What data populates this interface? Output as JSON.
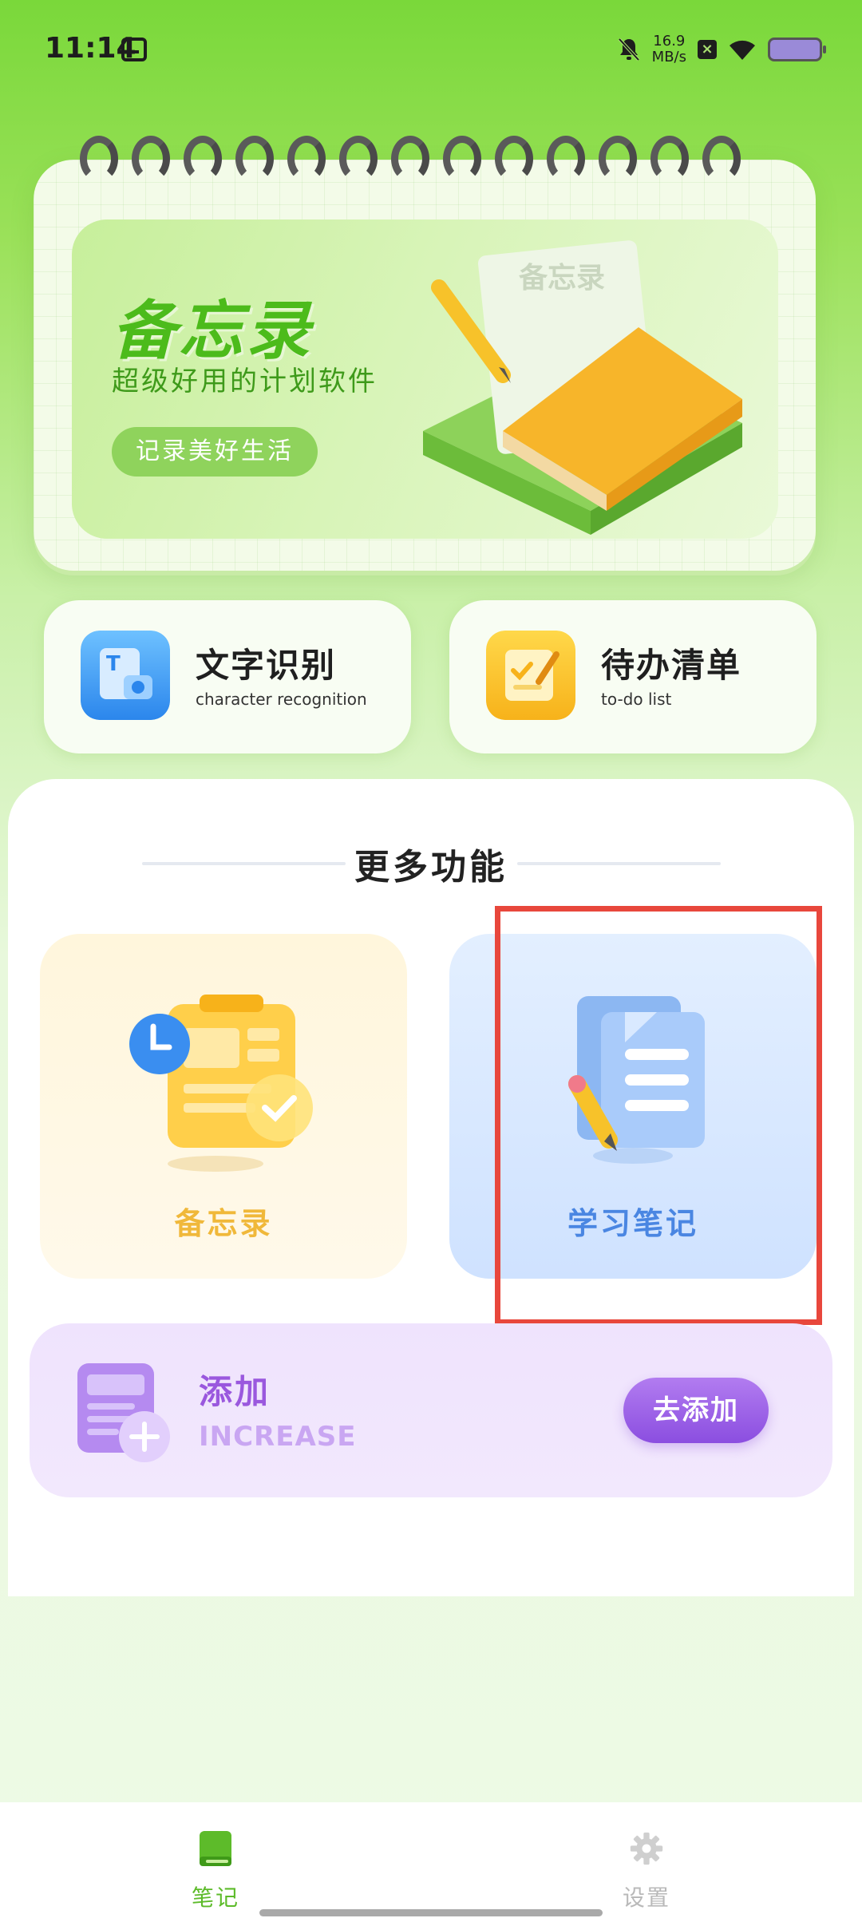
{
  "status_bar": {
    "time": "11:14",
    "net_speed_value": "16.9",
    "net_speed_unit": "MB/s",
    "x_badge": "×"
  },
  "banner": {
    "title": "备忘录",
    "subtitle": "超级好用的计划软件",
    "pill_label": "记录美好生活",
    "note_paper_text": "备忘录"
  },
  "quick_actions": [
    {
      "title": "文字识别",
      "subtitle": "character recognition",
      "icon": "text-scan-icon",
      "color": "#3b9cf0"
    },
    {
      "title": "待办清单",
      "subtitle": "to-do list",
      "icon": "todo-note-icon",
      "color": "#f7c22a"
    }
  ],
  "more_section": {
    "title": "更多功能",
    "cards": [
      {
        "label": "备忘录",
        "icon": "clipboard-clock-icon",
        "color": "#f0b83a"
      },
      {
        "label": "学习笔记",
        "icon": "document-pencil-icon",
        "color": "#4a86e2"
      }
    ]
  },
  "add_card": {
    "title": "添加",
    "subtitle": "INCREASE",
    "button_label": "去添加",
    "icon": "add-document-icon"
  },
  "bottom_nav": [
    {
      "label": "笔记",
      "icon": "book-icon",
      "active": true
    },
    {
      "label": "设置",
      "icon": "gear-icon",
      "active": false
    }
  ],
  "colors": {
    "accent_green": "#5dbb2a",
    "highlight_red": "#e8473c",
    "purple": "#9a58de"
  }
}
